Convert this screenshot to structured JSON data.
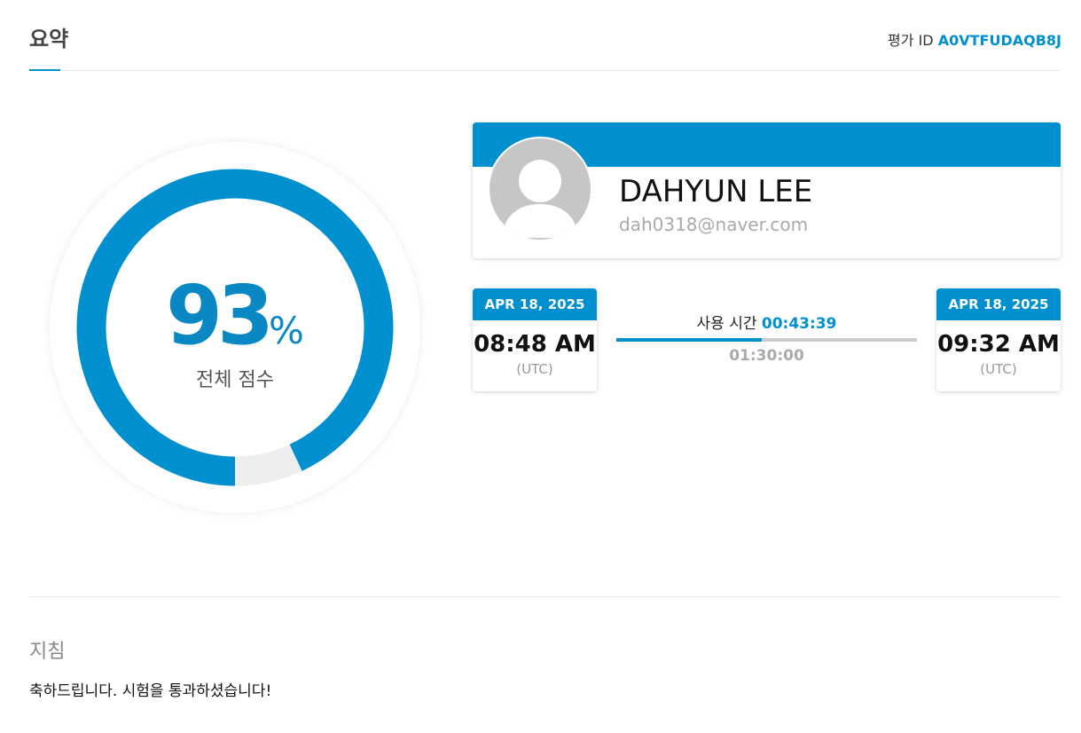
{
  "header": {
    "title": "요약",
    "eval_label": "평가 ID",
    "eval_id": "A0VTFUDAQB8J"
  },
  "score": {
    "value": 93,
    "value_text": "93",
    "unit": "%",
    "label": "전체 점수"
  },
  "profile": {
    "name": "DAHYUN LEE",
    "email": "dah0318@naver.com"
  },
  "start": {
    "date": "APR 18, 2025",
    "time": "08:48 AM",
    "tz": "(UTC)"
  },
  "end": {
    "date": "APR 18, 2025",
    "time": "09:32 AM",
    "tz": "(UTC)"
  },
  "usage": {
    "label": "사용 시간",
    "elapsed": "00:43:39",
    "limit": "01:30:00",
    "progress_fraction": 0.485
  },
  "guide": {
    "title": "지침",
    "text": "축하드립니다. 시험을 통과하셨습니다!"
  },
  "colors": {
    "accent": "#0090d0",
    "score_text": "#0a88c4",
    "ring_track": "#eeeeee"
  }
}
